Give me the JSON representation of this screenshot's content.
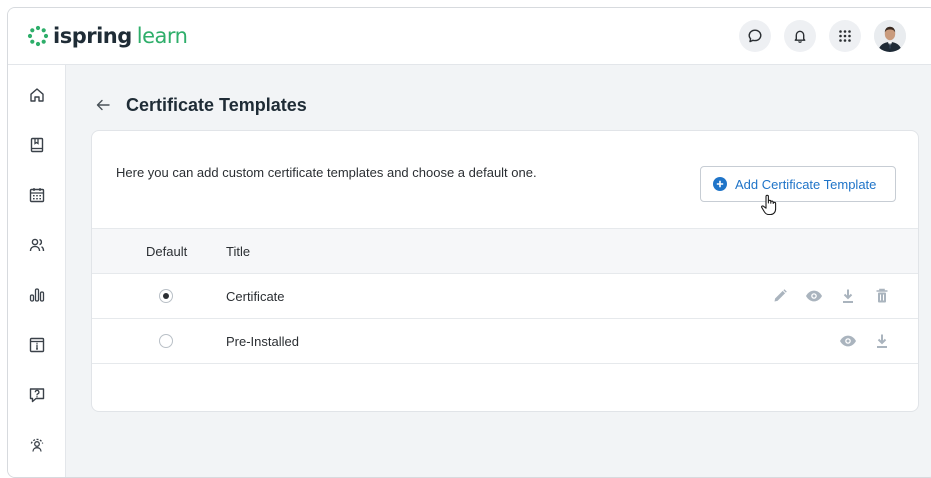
{
  "app": {
    "logo_part1": "ispring",
    "logo_part2": "learn",
    "brand_color": "#2eae6a"
  },
  "header": {
    "icons": [
      "chat-icon",
      "bell-icon",
      "apps-grid-icon"
    ],
    "avatar": "user-avatar"
  },
  "sidebar": {
    "items": [
      {
        "icon": "home-icon"
      },
      {
        "icon": "book-icon"
      },
      {
        "icon": "calendar-icon"
      },
      {
        "icon": "users-icon"
      },
      {
        "icon": "reports-icon"
      },
      {
        "icon": "info-box-icon"
      },
      {
        "icon": "question-icon"
      },
      {
        "icon": "user-settings-icon"
      }
    ]
  },
  "page": {
    "title": "Certificate Templates",
    "description": "Here you can add custom certificate templates and choose a default one.",
    "add_button_label": "Add Certificate Template"
  },
  "table": {
    "headers": {
      "default": "Default",
      "title": "Title"
    },
    "rows": [
      {
        "title": "Certificate",
        "default": true,
        "actions": [
          "edit-icon",
          "preview-icon",
          "download-icon",
          "delete-icon"
        ]
      },
      {
        "title": "Pre-Installed",
        "default": false,
        "actions": [
          "preview-icon",
          "download-icon"
        ]
      }
    ]
  },
  "colors": {
    "accent": "#1f74c8",
    "muted_icon": "#aab4be"
  }
}
